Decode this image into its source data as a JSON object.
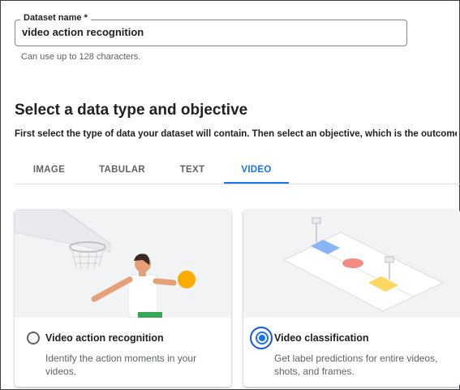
{
  "dataset_name": {
    "label": "Dataset name *",
    "value": "video action recognition",
    "helper": "Can use up to 128 characters."
  },
  "section": {
    "title": "Select a data type and objective",
    "description": "First select the type of data your dataset will contain. Then select an objective, which is the outcome"
  },
  "tabs": [
    {
      "label": "IMAGE",
      "selected": false
    },
    {
      "label": "TABULAR",
      "selected": false
    },
    {
      "label": "TEXT",
      "selected": false
    },
    {
      "label": "VIDEO",
      "selected": true
    }
  ],
  "objectives": [
    {
      "title": "Video action recognition",
      "description": "Identify the action moments in your videos.",
      "selected": false,
      "illustration": "basketball-player-illustration"
    },
    {
      "title": "Video classification",
      "description": "Get label predictions for entire videos, shots, and frames.",
      "selected": true,
      "illustration": "basketball-court-illustration"
    }
  ],
  "colors": {
    "accent": "#1a73e8",
    "focus_ring": "#1a56db",
    "text_primary": "#202124",
    "text_secondary": "#5f6368",
    "ball": "#f9ab00"
  }
}
